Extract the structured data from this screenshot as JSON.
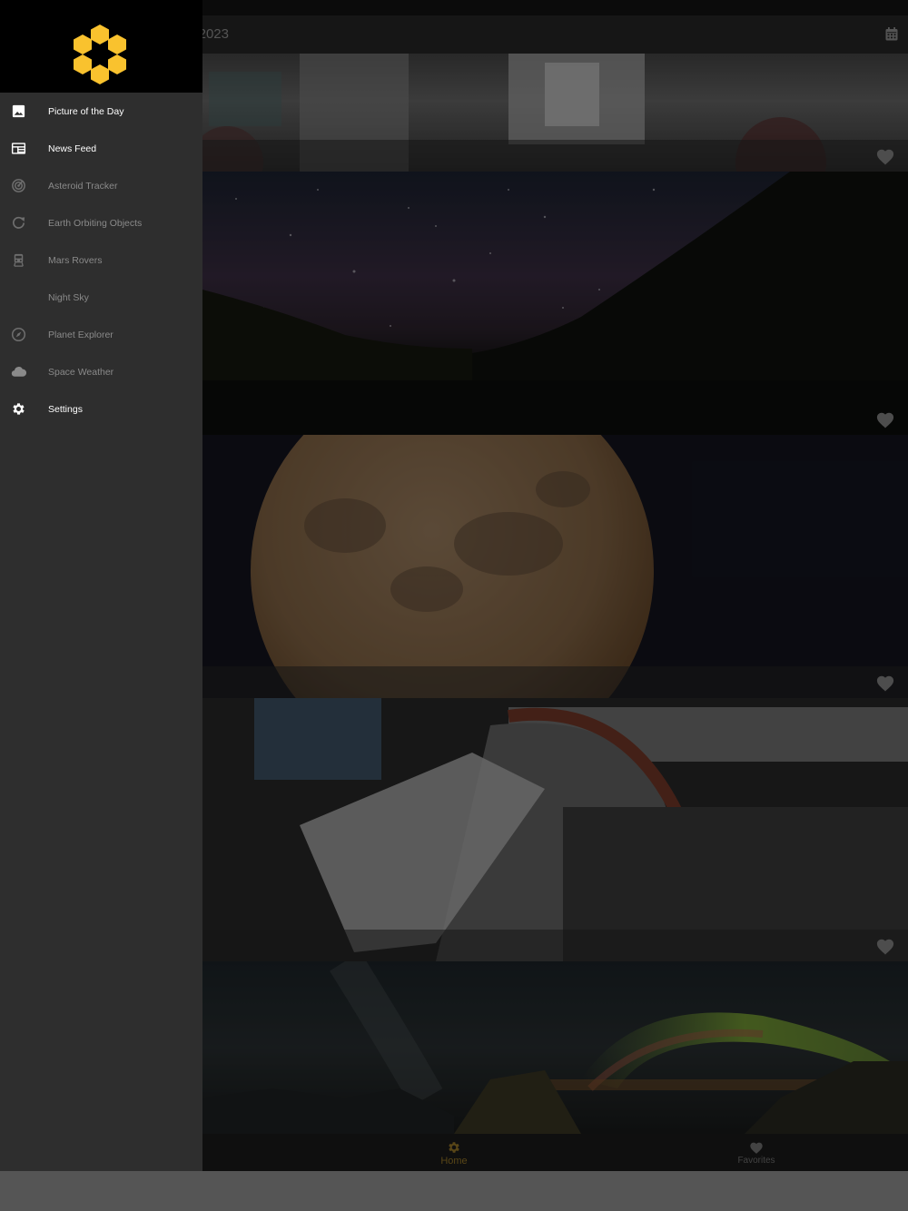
{
  "app_bar": {
    "title": "2023",
    "calendar_icon": "calendar-icon"
  },
  "drawer": {
    "logo_icon": "hexagon-mirror-logo",
    "items": [
      {
        "label": "Picture of the Day",
        "icon": "image-icon",
        "state": "active"
      },
      {
        "label": "News Feed",
        "icon": "newspaper-icon",
        "state": "active"
      },
      {
        "label": "Asteroid Tracker",
        "icon": "radar-icon",
        "state": "dim"
      },
      {
        "label": "Earth Orbiting Objects",
        "icon": "refresh-orbit-icon",
        "state": "dim"
      },
      {
        "label": "Mars Rovers",
        "icon": "rover-icon",
        "state": "dim"
      },
      {
        "label": "Night Sky",
        "icon": "moon-icon",
        "state": "dim"
      },
      {
        "label": "Planet Explorer",
        "icon": "compass-icon",
        "state": "dim"
      },
      {
        "label": "Space Weather",
        "icon": "cloud-icon",
        "state": "dim"
      },
      {
        "label": "Settings",
        "icon": "gear-icon",
        "state": "active"
      }
    ]
  },
  "feed": {
    "cards": [
      {
        "image": "anaglyph lunar rover",
        "favorite_icon": "heart-icon"
      },
      {
        "image": "starry sky over mountain lake",
        "favorite_icon": "heart-icon"
      },
      {
        "image": "full orange moon",
        "favorite_icon": "heart-icon"
      },
      {
        "image": "lunar rover wheel",
        "favorite_icon": "heart-icon"
      },
      {
        "image": "milky way and aurora over coast",
        "favorite_icon": null
      }
    ]
  },
  "bottom_nav": {
    "home_label": "Home",
    "favorites_label": "Favorites"
  },
  "colors": {
    "accent": "#f9c22e",
    "drawer_bg": "#2e2e2e",
    "header_bg": "#000000"
  }
}
